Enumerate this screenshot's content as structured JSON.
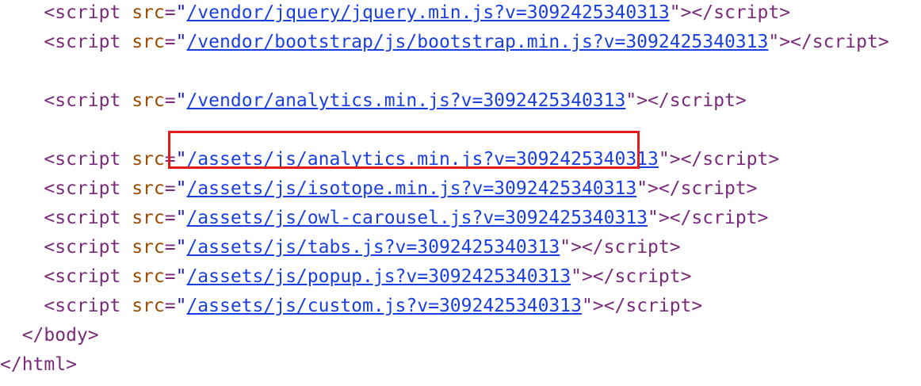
{
  "source": {
    "lines": [
      {
        "indent": "    ",
        "open": "<script",
        "attr": "src",
        "eq": "=",
        "quote": "\"",
        "url": "/vendor/jquery/jquery.min.js?v=3092425340313",
        "close": "\"></script>"
      },
      {
        "indent": "    ",
        "open": "<script",
        "attr": "src",
        "eq": "=",
        "quote": "\"",
        "url": "/vendor/bootstrap/js/bootstrap.min.js?v=3092425340313",
        "close": "\"></script>"
      },
      {
        "indent": "    ",
        "open": "<script",
        "attr": "src",
        "eq": "=",
        "quote": "\"",
        "url": "/vendor/analytics.min.js?v=3092425340313",
        "close": "\"></script>"
      },
      {
        "indent": "    ",
        "open": "<script",
        "attr": "src",
        "eq": "=",
        "quote": "\"",
        "url": "/assets/js/analytics.min.js?v=3092425340313",
        "close": "\"></script>"
      },
      {
        "indent": "    ",
        "open": "<script",
        "attr": "src",
        "eq": "=",
        "quote": "\"",
        "url": "/assets/js/isotope.min.js?v=3092425340313",
        "close": "\"></script>"
      },
      {
        "indent": "    ",
        "open": "<script",
        "attr": "src",
        "eq": "=",
        "quote": "\"",
        "url": "/assets/js/owl-carousel.js?v=3092425340313",
        "close": "\"></script>"
      },
      {
        "indent": "    ",
        "open": "<script",
        "attr": "src",
        "eq": "=",
        "quote": "\"",
        "url": "/assets/js/tabs.js?v=3092425340313",
        "close": "\"></script>"
      },
      {
        "indent": "    ",
        "open": "<script",
        "attr": "src",
        "eq": "=",
        "quote": "\"",
        "url": "/assets/js/popup.js?v=3092425340313",
        "close": "\"></script>"
      },
      {
        "indent": "    ",
        "open": "<script",
        "attr": "src",
        "eq": "=",
        "quote": "\"",
        "url": "/assets/js/custom.js?v=3092425340313",
        "close": "\"></script>"
      }
    ],
    "body_close": "  </body>",
    "html_close": "</html>"
  },
  "colors": {
    "tag": "#7b2a7b",
    "attr_name": "#9b4a00",
    "link": "#1a3fe0",
    "highlight": "#e41b1b"
  }
}
